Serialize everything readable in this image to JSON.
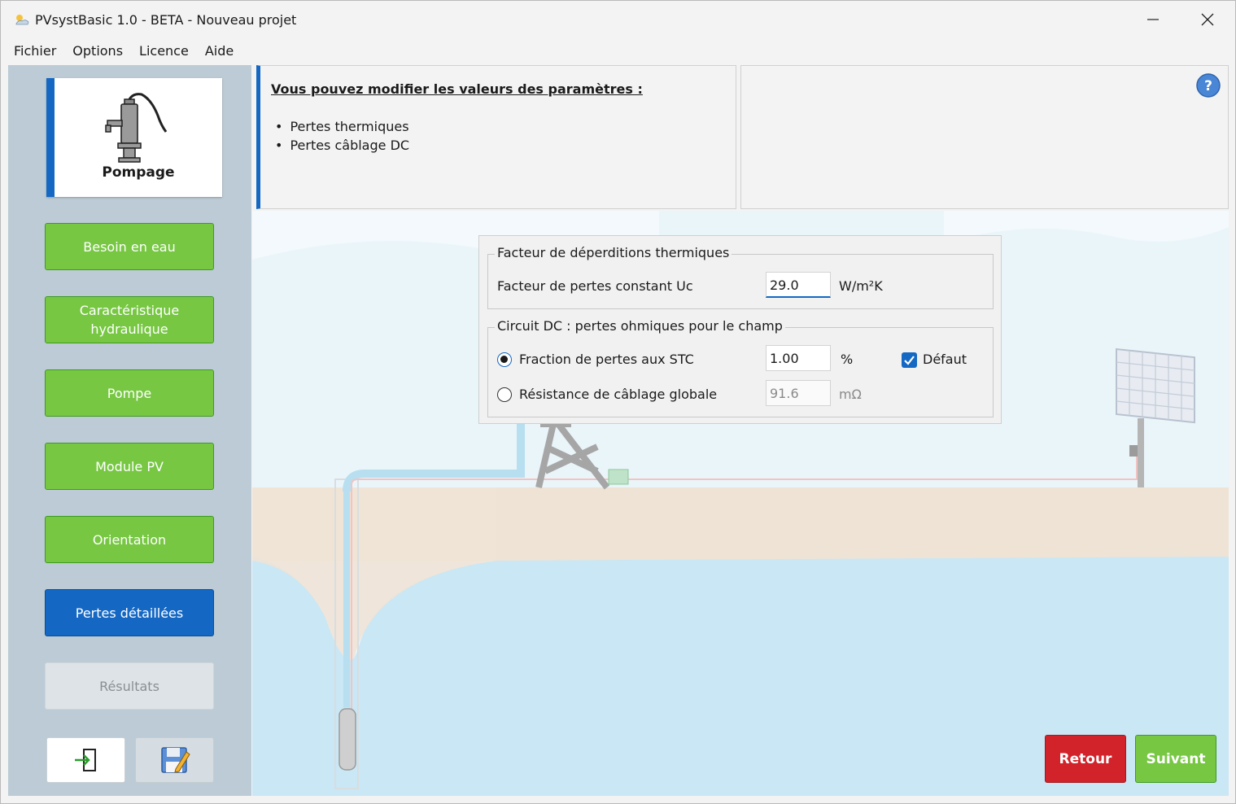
{
  "window": {
    "title": "PVsystBasic 1.0 - BETA - Nouveau projet"
  },
  "menu": [
    "Fichier",
    "Options",
    "Licence",
    "Aide"
  ],
  "sidebar": {
    "current_step": "Pompage",
    "items": [
      {
        "label": "Besoin en eau"
      },
      {
        "label": "Caractéristique hydraulique"
      },
      {
        "label": "Pompe"
      },
      {
        "label": "Module PV"
      },
      {
        "label": "Orientation"
      },
      {
        "label": "Pertes détaillées"
      },
      {
        "label": "Résultats"
      }
    ]
  },
  "info": {
    "heading": "Vous pouvez modifier les valeurs des paramètres :",
    "bullets": [
      "Pertes thermiques",
      "Pertes câblage DC"
    ]
  },
  "thermal": {
    "group_title": "Facteur de déperditions thermiques",
    "label": "Facteur de pertes constant Uc",
    "value": "29.0",
    "unit": "W/m²K"
  },
  "dc_circuit": {
    "group_title": "Circuit DC : pertes ohmiques pour le champ",
    "fraction": {
      "label": "Fraction de pertes aux STC",
      "value": "1.00",
      "unit": "%",
      "selected": true
    },
    "default_label": "Défaut",
    "default_checked": true,
    "resistance": {
      "label": "Résistance de câblage globale",
      "value": "91.6",
      "unit": "mΩ",
      "selected": false
    }
  },
  "buttons": {
    "back": "Retour",
    "next": "Suivant"
  },
  "colors": {
    "accent_blue": "#1468c4",
    "nav_green": "#77c743",
    "back_red": "#d2222a",
    "sidebar_bg": "#bccbd5",
    "water": "#c9e7f4",
    "ground": "#efe3d6"
  }
}
